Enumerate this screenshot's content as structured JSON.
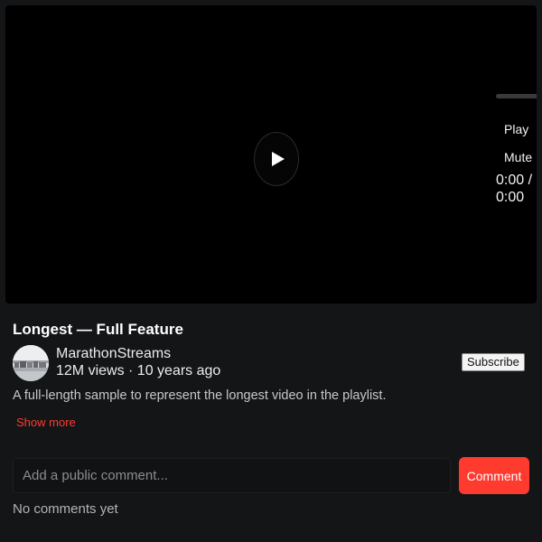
{
  "player": {
    "play_label": "Play",
    "mute_label": "Mute",
    "time": "0:00 / 0:00",
    "progress_fraction": 0,
    "overlay_icon": "play-icon"
  },
  "video": {
    "title": "Longest — Full Feature",
    "channel": {
      "name": "MarathonStreams",
      "avatar_icon": "channel-avatar",
      "subscribe_label": "Subscribe"
    },
    "stats": "12M views · 10 years ago",
    "description": "A full-length sample to represent the longest video in the playlist.",
    "show_more_label": "Show more"
  },
  "comments": {
    "input_placeholder": "Add a public comment...",
    "input_value": "",
    "submit_label": "Comment",
    "empty_text": "No comments yet"
  },
  "colors": {
    "accent": "#ff3b30",
    "background": "#141517",
    "video_background": "#000000"
  }
}
